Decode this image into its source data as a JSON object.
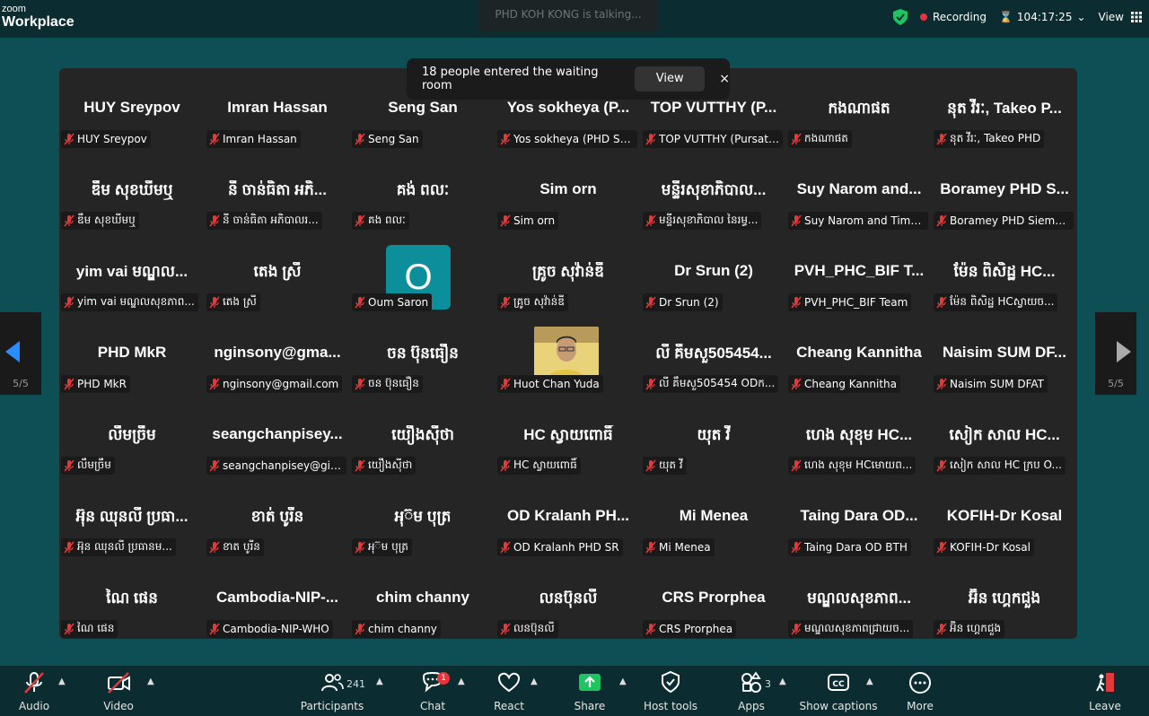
{
  "app": {
    "brand_top": "zoom",
    "brand_bottom": "Workplace"
  },
  "talking": "PHD KOH KONG is talking...",
  "status": {
    "recording_label": "Recording",
    "timer": "104:17:25",
    "view_label": "View"
  },
  "toast": {
    "message": "18 people entered the waiting room",
    "view_button": "View",
    "close_icon": "×"
  },
  "pager": {
    "left": "5/5",
    "right": "5/5"
  },
  "participants": [
    {
      "big": "HUY Sreypov",
      "label": "HUY Sreypov"
    },
    {
      "big": "Imran Hassan",
      "label": "Imran Hassan"
    },
    {
      "big": "Seng San",
      "label": "Seng San"
    },
    {
      "big": "Yos sokheya (P...",
      "label": "Yos sokheya (PHD Sva..."
    },
    {
      "big": "TOP VUTTHY (P...",
      "label": "TOP VUTTHY (Pursat P..."
    },
    {
      "big": "កងណាផត",
      "label": "កងណាផត"
    },
    {
      "big": "នុត វីរៈ, Takeo P...",
      "label": "នុត វីរៈ, Takeo PHD"
    },
    {
      "big": "ឌឹម សុខឃីមឬ",
      "label": "ឌឹម សុខឃីមឬ"
    },
    {
      "big": "នី ចាន់ធិតា អភិ...",
      "label": "នី ចាន់ធិតា អភិបាលរ..."
    },
    {
      "big": "គង់ ពលៈ",
      "label": "គង ពលៈ"
    },
    {
      "big": "Sim orn",
      "label": "Sim orn"
    },
    {
      "big": "មន្ទីរសុខាភិបាល...",
      "label": "មន្ទីរសុខាភិបាល នៃរម្ធ..."
    },
    {
      "big": "Suy Narom and...",
      "label": "Suy Narom and Tim S..."
    },
    {
      "big": "Boramey PHD S...",
      "label": "Boramey PHD SiemReap"
    },
    {
      "big": "yim vai មណ្ឌល...",
      "label": "yim vai មណ្ឌលសុខភាព..."
    },
    {
      "big": "តេង ស្រី",
      "label": "តេង ស្រី"
    },
    {
      "big": "",
      "label": "Oum Saron",
      "avatar": "O"
    },
    {
      "big": "គ្រូច សុវ៉ាន់ឌី",
      "label": "គ្រូច សុវ៉ាន់ឌី"
    },
    {
      "big": "Dr Srun (2)",
      "label": "Dr Srun (2)"
    },
    {
      "big": "PVH_PHC_BIF T...",
      "label": "PVH_PHC_BIF Team"
    },
    {
      "big": "ម៉ែន ពិសិដ្ឋ HC...",
      "label": "ម៉ែន ពិសិដ្ឋ HCស្វាយច..."
    },
    {
      "big": "PHD MkR",
      "label": "PHD MkR"
    },
    {
      "big": "nginsony@gma...",
      "label": "nginsony@gmail.com"
    },
    {
      "big": "ចន ប៊ុនធឿន",
      "label": "ចន ប៊ុនធឿន"
    },
    {
      "big": "",
      "label": "Huot Chan Yuda",
      "photo": true
    },
    {
      "big": "លី គឹមសួ505454...",
      "label": "លី គឹមសួ505454  ODក..."
    },
    {
      "big": "Cheang Kannitha",
      "label": "Cheang Kannitha"
    },
    {
      "big": "Naisim SUM DF...",
      "label": "Naisim SUM DFAT"
    },
    {
      "big": "លឹមច្រឹម",
      "label": "លឹមច្រឹម"
    },
    {
      "big": "seangchanpisey...",
      "label": "seangchanpisey@gia..."
    },
    {
      "big": "យឿងស៊ីថា",
      "label": "យឿងស៊ីថា"
    },
    {
      "big": "HC ស្វាយពោធិ៍",
      "label": "HC ស្វាយពោធិ៍"
    },
    {
      "big": "យុត វី",
      "label": "យុត វី"
    },
    {
      "big": "ហេង សុខុម HC...",
      "label": "ហេង សុខុម HCមោយព..."
    },
    {
      "big": "សៀក សាល HC...",
      "label": "សៀក សាល HC ក្រប O..."
    },
    {
      "big": "អ៊ុន ឈុនលី ប្រធា...",
      "label": "អ៊ុន ឈុនលី ប្រធានម..."
    },
    {
      "big": "ខាត់ បូរីន",
      "label": "ខាត បូរីន"
    },
    {
      "big": "អុ៊ម បុត្រ",
      "label": "អុ៊ម បុត្រ"
    },
    {
      "big": "OD Kralanh PH...",
      "label": "OD Kralanh PHD SR"
    },
    {
      "big": "Mi Menea",
      "label": "Mi Menea"
    },
    {
      "big": "Taing Dara OD...",
      "label": "Taing Dara OD BTH"
    },
    {
      "big": "KOFIH-Dr Kosal",
      "label": "KOFIH-Dr Kosal"
    },
    {
      "big": "ណៃ ផេន",
      "label": "ណៃ ផេន"
    },
    {
      "big": "Cambodia-NIP-...",
      "label": "Cambodia-NIP-WHO"
    },
    {
      "big": "chim channy",
      "label": "chim channy"
    },
    {
      "big": "លនប៊ុនលី",
      "label": "លនប៊ុនលី"
    },
    {
      "big": "CRS Prorphea",
      "label": "CRS Prorphea"
    },
    {
      "big": "មណ្ឌលសុខភាព...",
      "label": "មណ្ឌលសុខភាពជ្រាយច..."
    },
    {
      "big": "អ៊ិន ហ្គេកជួង",
      "label": "អ៊ិន ហ្គេកជួង"
    }
  ],
  "toolbar": {
    "audio": "Audio",
    "video": "Video",
    "participants": "Participants",
    "participants_count": "241",
    "chat": "Chat",
    "chat_badge": "1",
    "react": "React",
    "share": "Share",
    "host_tools": "Host tools",
    "apps": "Apps",
    "apps_count": "3",
    "captions": "Show captions",
    "more": "More",
    "leave": "Leave"
  },
  "colors": {
    "share_green": "#1ec45f",
    "recording_red": "#e8333b",
    "avatar_teal": "#0c8f9a",
    "mic_red": "#e03a3a"
  }
}
